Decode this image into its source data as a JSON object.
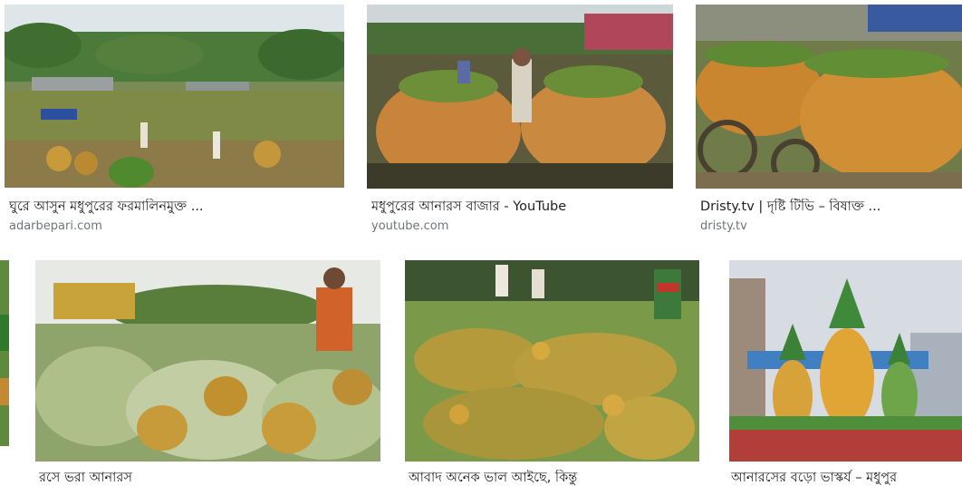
{
  "results": [
    {
      "title": "ঘুরে আসুন মধুপুরের ফরমালিনমুক্ত ...",
      "source": "adarbepari.com",
      "alt": "Pineapple market in Madhupur with carts of pineapples and trees"
    },
    {
      "title": "মধুপুরের আনারস বাজার - YouTube",
      "source": "youtube.com",
      "alt": "Men standing beside bicycles stacked high with pineapples"
    },
    {
      "title": "Dristy.tv | দৃষ্টি টিভি – বিষাক্ত ...",
      "source": "dristy.tv",
      "alt": "Carts loaded with ripe pineapples"
    },
    {
      "title": "রসে ভরা আনারস",
      "source": "",
      "alt": "Man in orange shirt among piles of fresh pineapples"
    },
    {
      "title": "আবাদ অনেক ভাল আইছে, কিন্তু",
      "source": "",
      "alt": "Heaps of pineapples at a market"
    },
    {
      "title": "আনারসের বড়ো ভাস্কর্য – মধুপুর",
      "source": "",
      "alt": "Giant pineapple sculptures on a roundabout"
    }
  ]
}
